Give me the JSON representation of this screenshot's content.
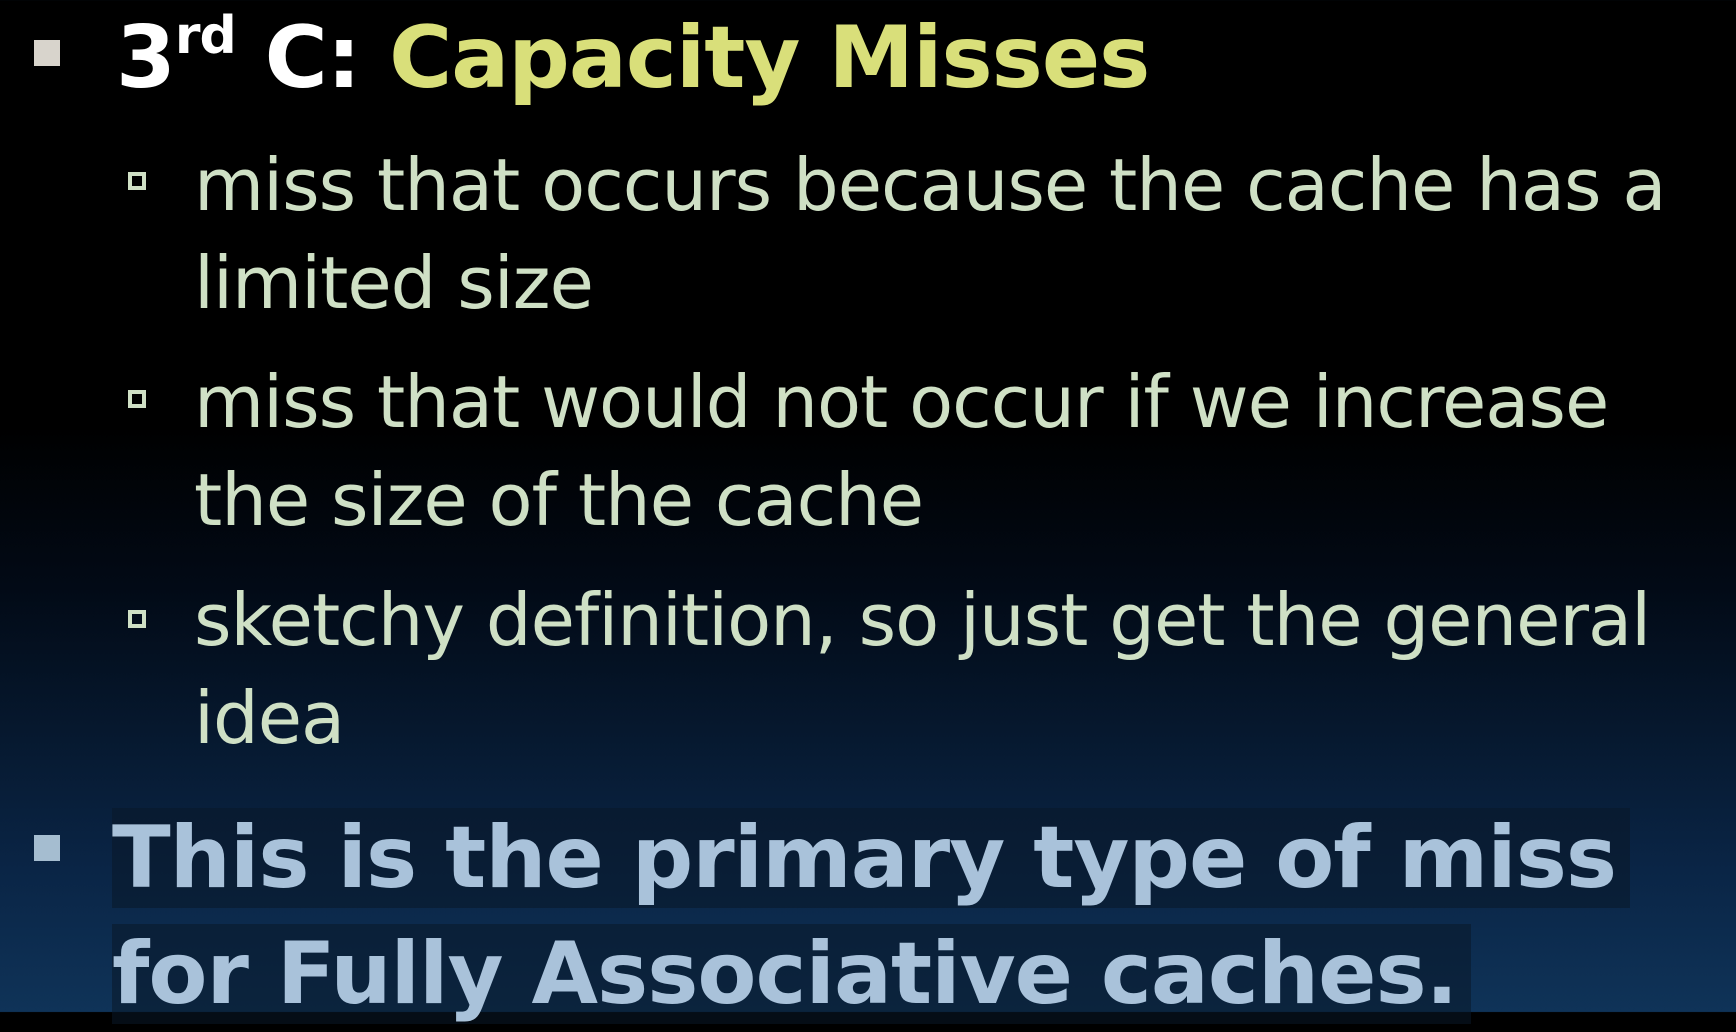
{
  "slide": {
    "heading": {
      "number": "3",
      "superscript": "rd",
      "prefix": " C: ",
      "highlight": "Capacity Misses"
    },
    "sub_bullets": [
      "miss that occurs because the cache has a limited size",
      "miss that would not occur if we increase the size of the cache",
      "sketchy definition, so just get the general idea"
    ],
    "bottom_bullet": "This is the primary type of miss for Fully Associative caches."
  },
  "colors": {
    "heading_white": "#ffffff",
    "heading_highlight": "#d9df7a",
    "sub_text": "#cfe0c5",
    "bottom_text": "#a9c2da",
    "background_top": "#000000",
    "background_bottom": "#0f3358"
  }
}
